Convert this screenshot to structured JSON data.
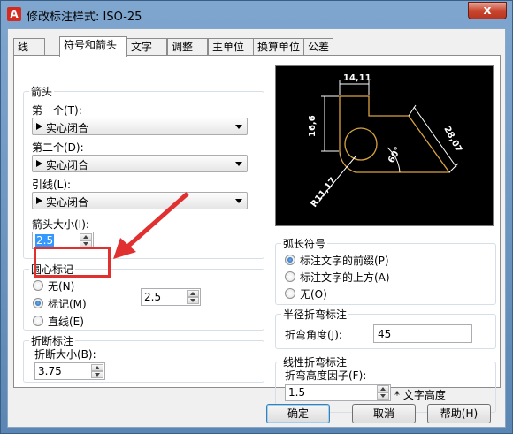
{
  "window": {
    "title": "修改标注样式: ISO-25",
    "app_icon_letter": "A",
    "close_label": "x"
  },
  "tabs": [
    {
      "label": "线"
    },
    {
      "label": "符号和箭头"
    },
    {
      "label": "文字"
    },
    {
      "label": "调整"
    },
    {
      "label": "主单位"
    },
    {
      "label": "换算单位"
    },
    {
      "label": "公差"
    }
  ],
  "arrowheads": {
    "title": "箭头",
    "first_label": "第一个(T):",
    "first_value": "实心闭合",
    "second_label": "第二个(D):",
    "second_value": "实心闭合",
    "leader_label": "引线(L):",
    "leader_value": "实心闭合",
    "size_label": "箭头大小(I):",
    "size_value": "2.5"
  },
  "center_marks": {
    "title": "圆心标记",
    "options": [
      "无(N)",
      "标记(M)",
      "直线(E)"
    ],
    "selected": 1,
    "size_value": "2.5"
  },
  "break": {
    "title": "折断标注",
    "size_label": "折断大小(B):",
    "size_value": "3.75"
  },
  "arc_length": {
    "title": "弧长符号",
    "options": [
      "标注文字的前缀(P)",
      "标注文字的上方(A)",
      "无(O)"
    ],
    "selected": 0
  },
  "radius_jog": {
    "title": "半径折弯标注",
    "angle_label": "折弯角度(J):",
    "angle_value": "45"
  },
  "linear_jog": {
    "title": "线性折弯标注",
    "height_label": "折弯高度因子(F):",
    "height_value": "1.5",
    "suffix": "* 文字高度"
  },
  "preview": {
    "dim_top": "14,11",
    "dim_left": "16,6",
    "dim_right": "28,07",
    "dim_radius": "R11,17",
    "dim_angle": "60°"
  },
  "buttons": {
    "ok": "确定",
    "cancel": "取消",
    "help": "帮助(H)"
  },
  "colors": {
    "highlight": "#e03030",
    "preview_geometry": "#d9a441"
  }
}
